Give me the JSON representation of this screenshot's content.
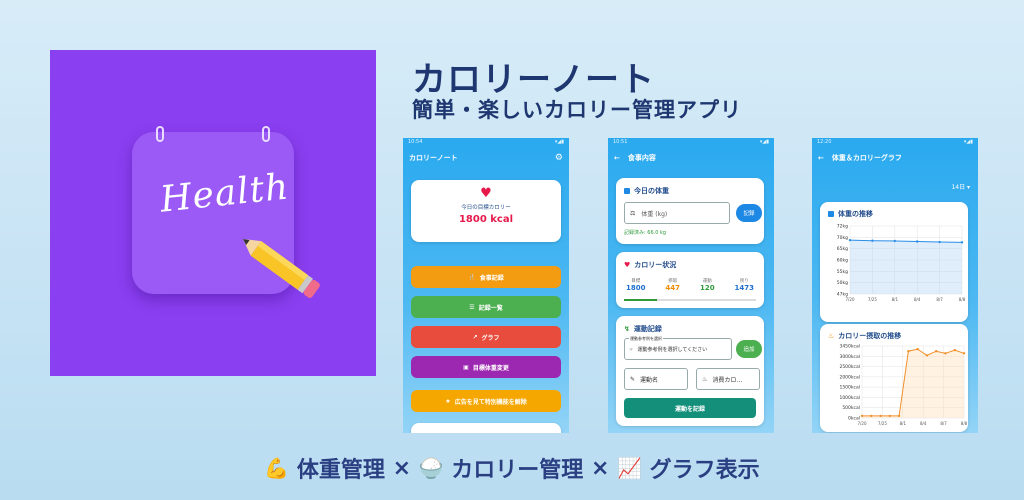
{
  "icon": {
    "word": "Health",
    "color": "#8a3ff0"
  },
  "heading": {
    "title": "カロリーノート",
    "subtitle": "簡単・楽しいカロリー管理アプリ"
  },
  "footer": {
    "item1": "体重管理",
    "sep1": "×",
    "item2": "カロリー管理",
    "sep2": "×",
    "item3": "グラフ表示"
  },
  "phone1": {
    "time": "10:54",
    "app_title": "カロリーノート",
    "card_label": "今日の目標カロリー",
    "card_value": "1800 kcal",
    "buttons": [
      {
        "label": "食事記録",
        "color": "#f39c12"
      },
      {
        "label": "記録一覧",
        "color": "#4caf50"
      },
      {
        "label": "グラフ",
        "color": "#e74c3c"
      },
      {
        "label": "目標体重変更",
        "color": "#9c27b0"
      },
      {
        "label": "広告を見て特別機能を解除",
        "color": "#f5a700"
      }
    ]
  },
  "phone2": {
    "time": "10:51",
    "title": "食事内容",
    "weight": {
      "heading": "今日の体重",
      "placeholder": "体重 (kg)",
      "button": "記録",
      "last": "記録済み: 66.0 kg"
    },
    "calorie": {
      "heading": "カロリー状況",
      "labels": [
        "目標",
        "摂取",
        "運動",
        "残り"
      ],
      "values": [
        "1800",
        "447",
        "120",
        "1473"
      ]
    },
    "exercise": {
      "heading": "運動記録",
      "select_label": "運動参考例を選択",
      "select_text": "運動参考例を選択してください",
      "add": "追加",
      "name_placeholder": "運動名",
      "kcal_placeholder": "消費カロ…",
      "submit": "運動を記録"
    }
  },
  "phone3": {
    "time": "12:20",
    "title": "体重＆カロリーグラフ",
    "range": "14日",
    "weight_chart": {
      "heading": "体重の推移"
    },
    "calorie_chart": {
      "heading": "カロリー摂取の推移"
    }
  },
  "chart_data": [
    {
      "type": "line",
      "title": "体重の推移",
      "ylabels": [
        "72kg",
        "70kg",
        "65kg",
        "60kg",
        "55kg",
        "50kg",
        "47kg"
      ],
      "xlabels": [
        "7/20",
        "7/25",
        "8/1",
        "8/4",
        "8/7",
        "8/8"
      ],
      "x": [
        "7/20",
        "7/25",
        "8/1",
        "8/4",
        "8/7",
        "8/8"
      ],
      "values": [
        66.8,
        66.6,
        66.5,
        66.3,
        66.1,
        66.0
      ],
      "ylim": [
        47,
        72
      ],
      "color": "#2a8ee6"
    },
    {
      "type": "line",
      "title": "カロリー摂取の推移",
      "ylabels": [
        "3450kcal",
        "3000kcal",
        "2500kcal",
        "2000kcal",
        "1500kcal",
        "1000kcal",
        "500kcal",
        "0kcal"
      ],
      "xlabels": [
        "7/20",
        "7/25",
        "8/1",
        "8/4",
        "8/7",
        "8/8"
      ],
      "x": [
        "7/20",
        "7/22",
        "7/25",
        "7/28",
        "8/1",
        "8/2",
        "8/3",
        "8/4",
        "8/5",
        "8/6",
        "8/7",
        "8/8"
      ],
      "values": [
        100,
        100,
        100,
        100,
        100,
        3200,
        3300,
        3000,
        3200,
        3100,
        3250,
        3100
      ],
      "ylim": [
        0,
        3450
      ],
      "color": "#f0902a"
    }
  ]
}
